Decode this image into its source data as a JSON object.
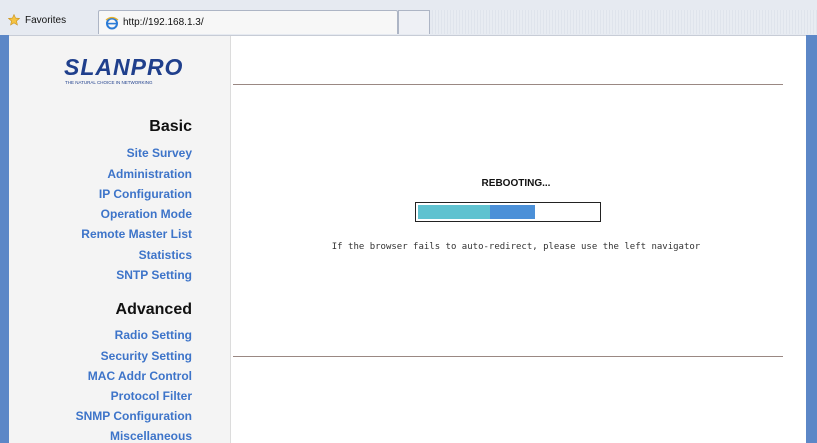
{
  "browser": {
    "favorites_label": "Favorites",
    "tab_url": "http://192.168.1.3/"
  },
  "logo": {
    "wordmark": "SLANPRO",
    "tagline": "THE NATURAL CHOICE IN NETWORKING"
  },
  "sidebar": {
    "basic_title": "Basic",
    "basic_items": [
      {
        "label": "Site Survey"
      },
      {
        "label": "Administration"
      },
      {
        "label": "IP Configuration"
      },
      {
        "label": "Operation Mode"
      },
      {
        "label": "Remote Master List"
      },
      {
        "label": "Statistics"
      },
      {
        "label": "SNTP Setting"
      }
    ],
    "advanced_title": "Advanced",
    "advanced_items": [
      {
        "label": "Radio Setting"
      },
      {
        "label": "Security Setting"
      },
      {
        "label": "MAC Addr Control"
      },
      {
        "label": "Protocol Filter"
      },
      {
        "label": "SNMP Configuration"
      },
      {
        "label": "Miscellaneous"
      }
    ]
  },
  "main": {
    "status_text": "REBOOTING...",
    "progress": {
      "segment_a_fraction": 0.4,
      "segment_b_fraction": 0.25,
      "color_a": "#5fc2d0",
      "color_b": "#4b90d8"
    },
    "help_text": "If the browser fails to auto-redirect, please use the left navigator"
  },
  "colors": {
    "frame": "#5c87c7",
    "link": "#3d74c9",
    "logo": "#1f3f8c"
  },
  "icons": {
    "favorites": "star-icon",
    "tab": "ie-browser-icon"
  }
}
